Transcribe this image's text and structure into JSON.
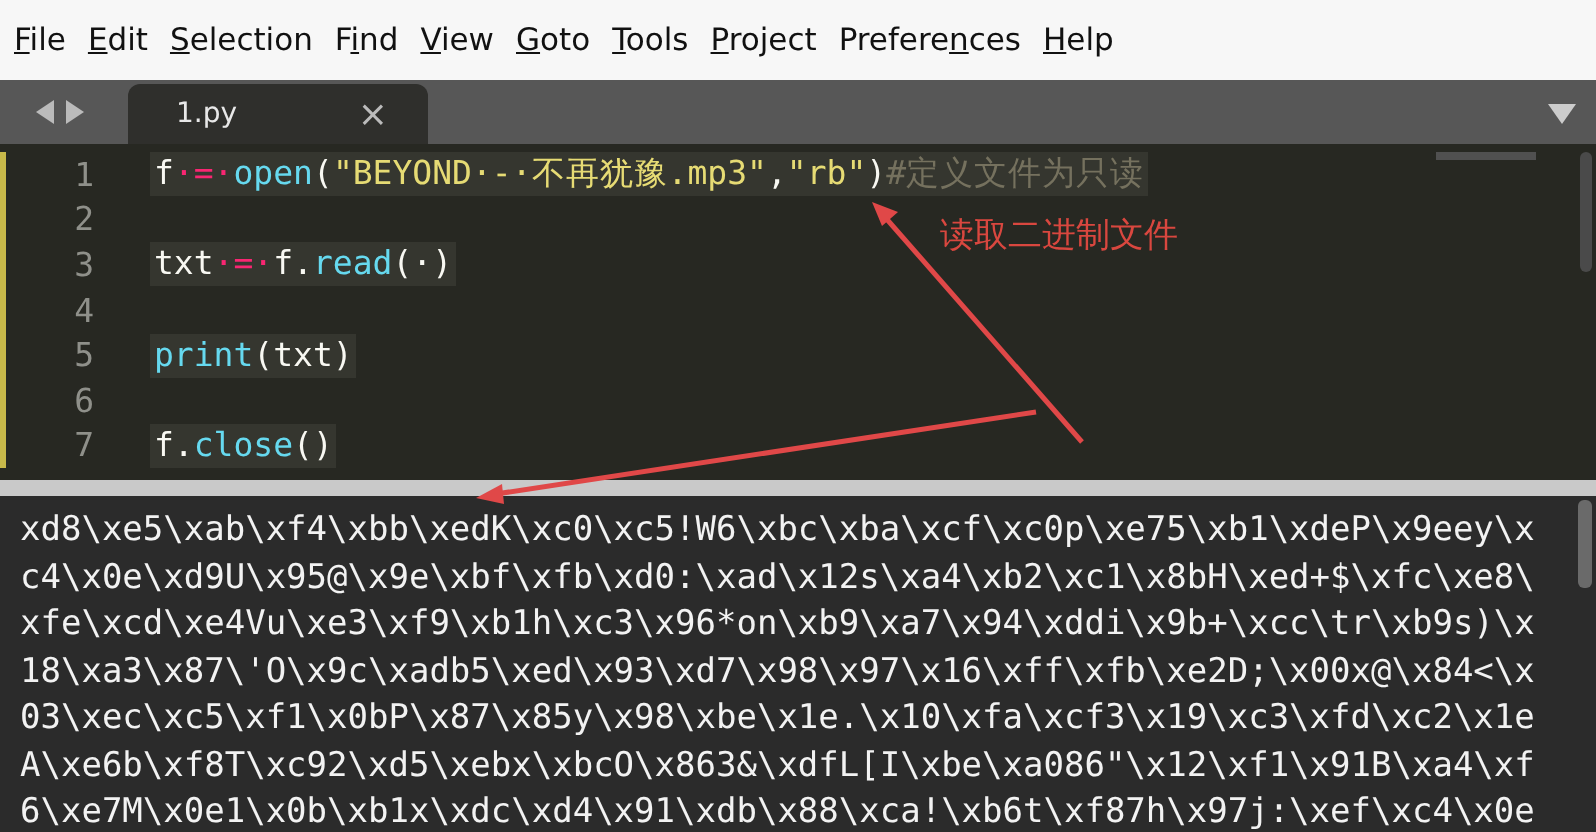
{
  "menu": [
    {
      "parts": [
        {
          "text": "F",
          "underlined": true
        },
        {
          "text": "ile",
          "underlined": false
        }
      ]
    },
    {
      "parts": [
        {
          "text": "E",
          "underlined": true
        },
        {
          "text": "dit",
          "underlined": false
        }
      ]
    },
    {
      "parts": [
        {
          "text": "S",
          "underlined": true
        },
        {
          "text": "election",
          "underlined": false
        }
      ]
    },
    {
      "parts": [
        {
          "text": "F",
          "underlined": false
        },
        {
          "text": "i",
          "underlined": true
        },
        {
          "text": "nd",
          "underlined": false
        }
      ]
    },
    {
      "parts": [
        {
          "text": "V",
          "underlined": true
        },
        {
          "text": "iew",
          "underlined": false
        }
      ]
    },
    {
      "parts": [
        {
          "text": "G",
          "underlined": true
        },
        {
          "text": "oto",
          "underlined": false
        }
      ]
    },
    {
      "parts": [
        {
          "text": "T",
          "underlined": true
        },
        {
          "text": "ools",
          "underlined": false
        }
      ]
    },
    {
      "parts": [
        {
          "text": "P",
          "underlined": true
        },
        {
          "text": "roject",
          "underlined": false
        }
      ]
    },
    {
      "parts": [
        {
          "text": "Prefere",
          "underlined": false
        },
        {
          "text": "n",
          "underlined": true
        },
        {
          "text": "ces",
          "underlined": false
        }
      ]
    },
    {
      "parts": [
        {
          "text": "H",
          "underlined": true
        },
        {
          "text": "elp",
          "underlined": false
        }
      ]
    }
  ],
  "tabs": [
    {
      "label": "1.py",
      "selected": true,
      "close": "×"
    }
  ],
  "editor": {
    "lines": [
      {
        "number": "1",
        "tokens": [
          {
            "kind": "plain",
            "text": "f"
          },
          {
            "kind": "op",
            "text": "·=·"
          },
          {
            "kind": "func",
            "text": "open"
          },
          {
            "kind": "plain",
            "text": "("
          },
          {
            "kind": "string",
            "text": "\"BEYOND·-·不再犹豫.mp3\""
          },
          {
            "kind": "plain",
            "text": ","
          },
          {
            "kind": "string",
            "text": "\"rb\""
          },
          {
            "kind": "plain",
            "text": ")"
          },
          {
            "kind": "comment",
            "text": "#定义文件为只读"
          }
        ]
      },
      {
        "number": "2"
      },
      {
        "number": "3",
        "tokens": [
          {
            "kind": "plain",
            "text": "txt"
          },
          {
            "kind": "op",
            "text": "·=·"
          },
          {
            "kind": "plain",
            "text": "f."
          },
          {
            "kind": "func",
            "text": "read"
          },
          {
            "kind": "plain",
            "text": "(·)"
          }
        ]
      },
      {
        "number": "4"
      },
      {
        "number": "5",
        "tokens": [
          {
            "kind": "func",
            "text": "print"
          },
          {
            "kind": "plain",
            "text": "(txt)"
          }
        ]
      },
      {
        "number": "6"
      },
      {
        "number": "7",
        "tokens": [
          {
            "kind": "plain",
            "text": "f."
          },
          {
            "kind": "func",
            "text": "close"
          },
          {
            "kind": "plain",
            "text": "()"
          }
        ]
      }
    ]
  },
  "annotation": {
    "label": "读取二进制文件"
  },
  "output": {
    "lines": [
      "xd8\\xe5\\xab\\xf4\\xbb\\xedK\\xc0\\xc5!W6\\xbc\\xba\\xcf\\xc0p\\xe75\\xb1\\xdeP\\x9eey\\x",
      "c4\\x0e\\xd9U\\x95@\\x9e\\xbf\\xfb\\xd0:\\xad\\x12s\\xa4\\xb2\\xc1\\x8bH\\xed+$\\xfc\\xe8\\",
      "xfe\\xcd\\xe4Vu\\xe3\\xf9\\xb1h\\xc3\\x96*on\\xb9\\xa7\\x94\\xddi\\x9b+\\xcc\\tr\\xb9s)\\x",
      "18\\xa3\\x87\\'O\\x9c\\xadb5\\xed\\x93\\xd7\\x98\\x97\\x16\\xff\\xfb\\xe2D;\\x00x@\\x84<\\x",
      "03\\xec\\xc5\\xf1\\x0bP\\x87\\x85y\\x98\\xbe\\x1e.\\x10\\xfa\\xcf3\\x19\\xc3\\xfd\\xc2\\x1e",
      "A\\xe6b\\xf8T\\xc92\\xd5\\xebx\\xbcO\\x863&\\xdfL[I\\xbe\\xa086\"\\x12\\xf1\\x91B\\xa4\\xf",
      "6\\xe7M\\x0e1\\x0b\\xb1x\\xdc\\xd4\\x91\\xdb\\x88\\xca!\\xb6t\\xf87h\\x97j:\\xef\\xc4\\x0e"
    ]
  }
}
